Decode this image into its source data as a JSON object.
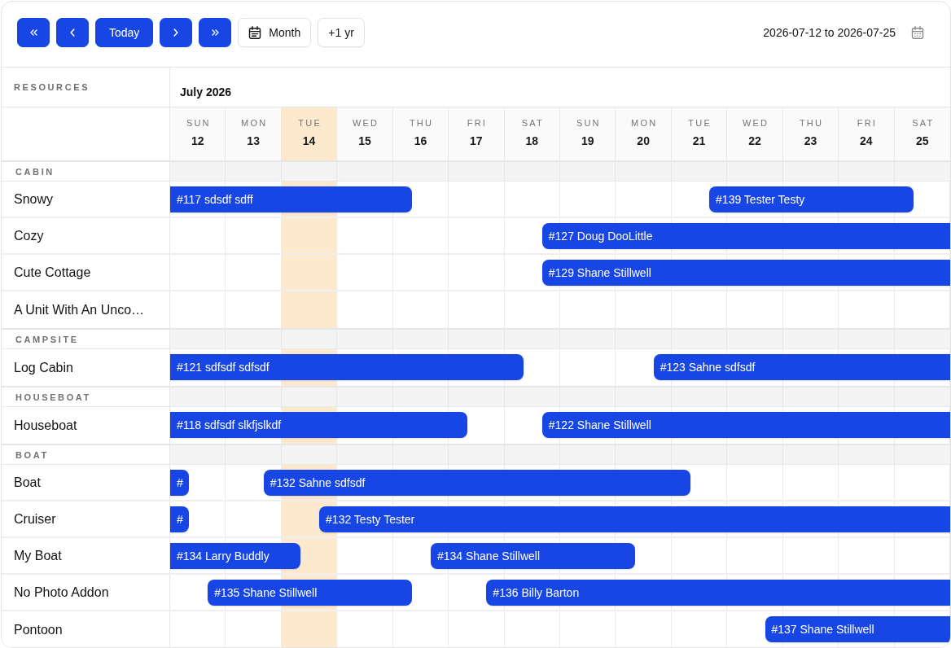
{
  "toolbar": {
    "buttons": [
      {
        "kind": "jump_back"
      },
      {
        "kind": "back"
      },
      {
        "kind": "today",
        "label": "Today"
      },
      {
        "kind": "forward"
      },
      {
        "kind": "jump_forward"
      },
      {
        "kind": "view",
        "label": "Month"
      },
      {
        "kind": "extend",
        "label": "+1 yr"
      }
    ],
    "date_range": "2026-07-12 to 2026-07-25"
  },
  "timeline": {
    "resources_heading": "RESOURCES",
    "month": "July 2026",
    "days": [
      {
        "weekday": "SUN",
        "day": "12",
        "today": false
      },
      {
        "weekday": "MON",
        "day": "13",
        "today": false
      },
      {
        "weekday": "TUE",
        "day": "14",
        "today": true
      },
      {
        "weekday": "WED",
        "day": "15",
        "today": false
      },
      {
        "weekday": "THU",
        "day": "16",
        "today": false
      },
      {
        "weekday": "FRI",
        "day": "17",
        "today": false
      },
      {
        "weekday": "SAT",
        "day": "18",
        "today": false
      },
      {
        "weekday": "SUN",
        "day": "19",
        "today": false
      },
      {
        "weekday": "MON",
        "day": "20",
        "today": false
      },
      {
        "weekday": "TUE",
        "day": "21",
        "today": false
      },
      {
        "weekday": "WED",
        "day": "22",
        "today": false
      },
      {
        "weekday": "THU",
        "day": "23",
        "today": false
      },
      {
        "weekday": "FRI",
        "day": "24",
        "today": false
      },
      {
        "weekday": "SAT",
        "day": "25",
        "today": false
      }
    ]
  },
  "groups": [
    {
      "name": "CABIN",
      "resources": [
        {
          "name": "Snowy",
          "bookings": [
            {
              "label": "#117 sdsdf sdff"
            },
            {
              "label": "#139 Tester Testy"
            }
          ],
          "days": [
            {
              "check_in": false,
              "check_out": false
            },
            {
              "check_in": false,
              "check_out": false
            },
            {
              "check_in": false,
              "check_out": false
            },
            {
              "check_in": false,
              "check_out": false
            },
            {
              "check_in": false,
              "check_out": true
            },
            {
              "check_in": false,
              "check_out": false
            },
            {
              "check_in": false,
              "check_out": false
            },
            {
              "check_in": false,
              "check_out": false
            },
            {
              "check_in": false,
              "check_out": false
            },
            {
              "check_in": true,
              "check_out": false
            },
            {
              "check_in": false,
              "check_out": false
            },
            {
              "check_in": false,
              "check_out": false
            },
            {
              "check_in": false,
              "check_out": false
            },
            {
              "check_in": false,
              "check_out": true
            }
          ]
        },
        {
          "name": "Cozy",
          "bookings": [
            {
              "label": "#127 Doug DooLittle"
            }
          ],
          "days": [
            {
              "check_in": false,
              "check_out": false
            },
            {
              "check_in": false,
              "check_out": false
            },
            {
              "check_in": false,
              "check_out": false
            },
            {
              "check_in": false,
              "check_out": false
            },
            {
              "check_in": false,
              "check_out": false
            },
            {
              "check_in": false,
              "check_out": false
            },
            {
              "check_in": true,
              "check_out": false
            },
            {
              "check_in": false,
              "check_out": false
            },
            {
              "check_in": false,
              "check_out": false
            },
            {
              "check_in": false,
              "check_out": false
            },
            {
              "check_in": false,
              "check_out": false
            },
            {
              "check_in": false,
              "check_out": false
            },
            {
              "check_in": false,
              "check_out": false
            },
            {
              "check_in": false,
              "check_out": false
            }
          ]
        },
        {
          "name": "Cute Cottage",
          "bookings": [
            {
              "label": "#129 Shane Stillwell"
            }
          ],
          "days": [
            {
              "check_in": false,
              "check_out": false
            },
            {
              "check_in": false,
              "check_out": false
            },
            {
              "check_in": false,
              "check_out": false
            },
            {
              "check_in": false,
              "check_out": false
            },
            {
              "check_in": false,
              "check_out": false
            },
            {
              "check_in": false,
              "check_out": false
            },
            {
              "check_in": true,
              "check_out": false
            },
            {
              "check_in": false,
              "check_out": false
            },
            {
              "check_in": false,
              "check_out": false
            },
            {
              "check_in": false,
              "check_out": false
            },
            {
              "check_in": false,
              "check_out": false
            },
            {
              "check_in": false,
              "check_out": false
            },
            {
              "check_in": false,
              "check_out": false
            },
            {
              "check_in": false,
              "check_out": false
            }
          ]
        },
        {
          "name": "A Unit With An Unco…",
          "days": [
            {
              "check_in": false,
              "check_out": false
            },
            {
              "check_in": false,
              "check_out": false
            },
            {
              "check_in": false,
              "check_out": false
            },
            {
              "check_in": false,
              "check_out": false
            },
            {
              "check_in": false,
              "check_out": false
            },
            {
              "check_in": false,
              "check_out": false
            },
            {
              "check_in": false,
              "check_out": false
            },
            {
              "check_in": false,
              "check_out": false
            },
            {
              "check_in": false,
              "check_out": false
            },
            {
              "check_in": false,
              "check_out": false
            },
            {
              "check_in": false,
              "check_out": false
            },
            {
              "check_in": false,
              "check_out": false
            },
            {
              "check_in": false,
              "check_out": false
            },
            {
              "check_in": false,
              "check_out": false
            }
          ]
        }
      ]
    },
    {
      "name": "CAMPSITE",
      "resources": [
        {
          "name": "Log Cabin",
          "bookings": [
            {
              "label": "#121 sdfsdf sdfsdf"
            },
            {
              "label": "#123 Sahne sdfsdf"
            }
          ],
          "days": [
            {
              "check_in": false,
              "check_out": false
            },
            {
              "check_in": false,
              "check_out": false
            },
            {
              "check_in": false,
              "check_out": false
            },
            {
              "check_in": false,
              "check_out": false
            },
            {
              "check_in": false,
              "check_out": false
            },
            {
              "check_in": false,
              "check_out": false
            },
            {
              "check_in": false,
              "check_out": true
            },
            {
              "check_in": false,
              "check_out": false
            },
            {
              "check_in": true,
              "check_out": false
            },
            {
              "check_in": false,
              "check_out": false
            },
            {
              "check_in": false,
              "check_out": false
            },
            {
              "check_in": false,
              "check_out": false
            },
            {
              "check_in": false,
              "check_out": false
            },
            {
              "check_in": false,
              "check_out": false
            }
          ]
        }
      ]
    },
    {
      "name": "HOUSEBOAT",
      "resources": [
        {
          "name": "Houseboat",
          "bookings": [
            {
              "label": "#118 sdfsdf slkfjslkdf"
            },
            {
              "label": "#122 Shane Stillwell"
            }
          ],
          "days": [
            {
              "check_in": false,
              "check_out": false
            },
            {
              "check_in": false,
              "check_out": false
            },
            {
              "check_in": false,
              "check_out": false
            },
            {
              "check_in": false,
              "check_out": false
            },
            {
              "check_in": false,
              "check_out": false
            },
            {
              "check_in": false,
              "check_out": true
            },
            {
              "check_in": true,
              "check_out": false
            },
            {
              "check_in": false,
              "check_out": false
            },
            {
              "check_in": false,
              "check_out": false
            },
            {
              "check_in": false,
              "check_out": false
            },
            {
              "check_in": false,
              "check_out": false
            },
            {
              "check_in": false,
              "check_out": false
            },
            {
              "check_in": false,
              "check_out": false
            },
            {
              "check_in": false,
              "check_out": false
            }
          ]
        }
      ]
    },
    {
      "name": "BOAT",
      "resources": [
        {
          "name": "Boat",
          "bookings": [
            {
              "label": "#"
            },
            {
              "label": "#132 Sahne sdfsdf"
            }
          ],
          "days": [
            {
              "check_in": false,
              "check_out": true
            },
            {
              "check_in": true,
              "check_out": false
            },
            {
              "check_in": false,
              "check_out": false
            },
            {
              "check_in": false,
              "check_out": false
            },
            {
              "check_in": false,
              "check_out": false
            },
            {
              "check_in": false,
              "check_out": false
            },
            {
              "check_in": false,
              "check_out": false
            },
            {
              "check_in": false,
              "check_out": false
            },
            {
              "check_in": false,
              "check_out": false
            },
            {
              "check_in": false,
              "check_out": true
            },
            {
              "check_in": false,
              "check_out": false
            },
            {
              "check_in": false,
              "check_out": false
            },
            {
              "check_in": false,
              "check_out": false
            },
            {
              "check_in": false,
              "check_out": false
            }
          ]
        },
        {
          "name": "Cruiser",
          "bookings": [
            {
              "label": "#"
            },
            {
              "label": "#132 Testy Tester"
            }
          ],
          "days": [
            {
              "check_in": false,
              "check_out": true
            },
            {
              "check_in": false,
              "check_out": false
            },
            {
              "check_in": true,
              "check_out": false
            },
            {
              "check_in": false,
              "check_out": false
            },
            {
              "check_in": false,
              "check_out": false
            },
            {
              "check_in": false,
              "check_out": false
            },
            {
              "check_in": false,
              "check_out": false
            },
            {
              "check_in": false,
              "check_out": false
            },
            {
              "check_in": false,
              "check_out": false
            },
            {
              "check_in": false,
              "check_out": false
            },
            {
              "check_in": false,
              "check_out": false
            },
            {
              "check_in": false,
              "check_out": false
            },
            {
              "check_in": false,
              "check_out": false
            },
            {
              "check_in": false,
              "check_out": false
            }
          ]
        },
        {
          "name": "My Boat",
          "bookings": [
            {
              "label": "#134 Larry Buddly"
            },
            {
              "label": "#134 Shane Stillwell"
            }
          ],
          "days": [
            {
              "check_in": false,
              "check_out": false
            },
            {
              "check_in": false,
              "check_out": false
            },
            {
              "check_in": false,
              "check_out": true
            },
            {
              "check_in": false,
              "check_out": false
            },
            {
              "check_in": true,
              "check_out": false
            },
            {
              "check_in": false,
              "check_out": false
            },
            {
              "check_in": false,
              "check_out": false
            },
            {
              "check_in": false,
              "check_out": false
            },
            {
              "check_in": false,
              "check_out": true
            },
            {
              "check_in": false,
              "check_out": false
            },
            {
              "check_in": false,
              "check_out": false
            },
            {
              "check_in": false,
              "check_out": false
            },
            {
              "check_in": false,
              "check_out": false
            },
            {
              "check_in": false,
              "check_out": false
            }
          ]
        },
        {
          "name": "No Photo Addon",
          "bookings": [
            {
              "label": "#135 Shane Stillwell"
            },
            {
              "label": "#136 Billy Barton"
            }
          ],
          "days": [
            {
              "check_in": true,
              "check_out": false
            },
            {
              "check_in": false,
              "check_out": false
            },
            {
              "check_in": false,
              "check_out": false
            },
            {
              "check_in": false,
              "check_out": false
            },
            {
              "check_in": false,
              "check_out": true
            },
            {
              "check_in": true,
              "check_out": false
            },
            {
              "check_in": false,
              "check_out": false
            },
            {
              "check_in": false,
              "check_out": false
            },
            {
              "check_in": false,
              "check_out": false
            },
            {
              "check_in": false,
              "check_out": false
            },
            {
              "check_in": false,
              "check_out": false
            },
            {
              "check_in": false,
              "check_out": false
            },
            {
              "check_in": false,
              "check_out": false
            },
            {
              "check_in": false,
              "check_out": false
            }
          ]
        },
        {
          "name": "Pontoon",
          "bookings": [
            {
              "label": "#137 Shane Stillwell"
            }
          ],
          "days": [
            {
              "check_in": false,
              "check_out": false
            },
            {
              "check_in": false,
              "check_out": false
            },
            {
              "check_in": false,
              "check_out": false
            },
            {
              "check_in": false,
              "check_out": false
            },
            {
              "check_in": false,
              "check_out": false
            },
            {
              "check_in": false,
              "check_out": false
            },
            {
              "check_in": false,
              "check_out": false
            },
            {
              "check_in": false,
              "check_out": false
            },
            {
              "check_in": false,
              "check_out": false
            },
            {
              "check_in": false,
              "check_out": false
            },
            {
              "check_in": true,
              "check_out": false
            },
            {
              "check_in": false,
              "check_out": false
            },
            {
              "check_in": false,
              "check_out": false
            },
            {
              "check_in": false,
              "check_out": false
            }
          ]
        }
      ]
    }
  ]
}
